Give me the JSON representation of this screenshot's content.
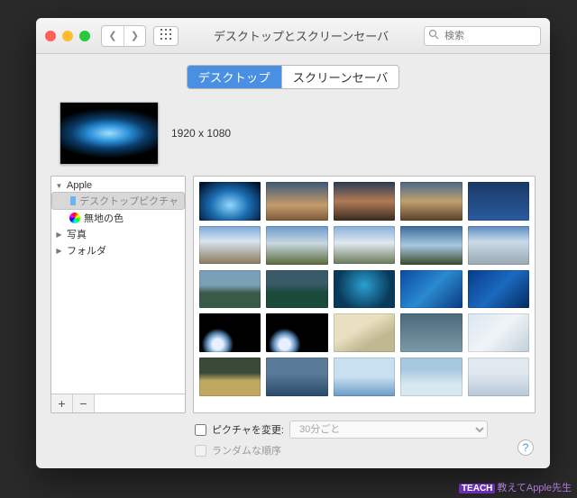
{
  "window": {
    "title": "デスクトップとスクリーンセーバ",
    "search_placeholder": "検索"
  },
  "tabs": {
    "desktop": "デスクトップ",
    "screensaver": "スクリーンセーバ",
    "active": 0
  },
  "preview": {
    "dimensions": "1920 x 1080"
  },
  "sidebar": {
    "items": [
      {
        "label": "Apple",
        "expanded": true,
        "children": [
          {
            "label": "デスクトップピクチャ",
            "icon": "folder",
            "selected": true
          },
          {
            "label": "無地の色",
            "icon": "colorwheel"
          }
        ]
      },
      {
        "label": "写真",
        "expanded": false
      },
      {
        "label": "フォルダ",
        "expanded": false
      }
    ],
    "add": "+",
    "remove": "−"
  },
  "options": {
    "change_label": "ピクチャを変更:",
    "interval": "30分ごと",
    "random_label": "ランダムな順序"
  },
  "help": "?",
  "watermark": {
    "tag": "TEACH",
    "text": "教えてApple先生"
  },
  "thumbs": [
    "radial-gradient(ellipse at 50% 60%, #8fd9ff, #1a6bb0 45%, #02152e 90%)",
    "linear-gradient(#3a5a78 0%, #c59a6a 60%, #7a5a3a 100%)",
    "linear-gradient(to bottom, #2b3d55 0%, #b07a55 50%, #3a2a20 100%)",
    "linear-gradient(#4a6a88 0%, #c0a070 50%, #5a4028 100%)",
    "linear-gradient(#1a3a66, #2a5aa0)",
    "linear-gradient(#7aa8d8 0%, #d8e4ef 40%, #8a7a5a 100%)",
    "linear-gradient(#6a9acc 0%, #c8d8e0 45%, #5a6a3a 100%)",
    "linear-gradient(#88b0d8 0%, #e0e8ef 45%, #6a7a5a 100%)",
    "linear-gradient(#3a6a9a 0%, #a8c8e0 50%, #3a4a2a 100%)",
    "linear-gradient(#5a8ac0 0%, #c8dae8 40%, #9aa8b0 100%)",
    "linear-gradient(#7aa0b8 40%, #3a5a48 60%)",
    "linear-gradient(#3a5a6a 35%, #1a4a3a 60%)",
    "radial-gradient(circle at 50% 40%, #2aa0d0, #0a3a5a 70%)",
    "linear-gradient(135deg, #0a4aa0, #2a8ad0, #0a3a80)",
    "linear-gradient(135deg, #083a88, #1a6ac0, #062a60)",
    "radial-gradient(circle at 30% 80%, #e8f0ff 10%, #6090c0 20%, #000 30%, #000 100%)",
    "radial-gradient(circle at 30% 80%, #e8f0ff 10%, #6090c0 20%, #000 30%, #000 100%)",
    "linear-gradient(150deg, #e8e0c0 40%, #c0b890 70%)",
    "linear-gradient(#4a6a7a, #7a9aa8)",
    "linear-gradient(135deg, #d8e8f0, #f0f4f8, #c0d0d8)",
    "linear-gradient(#3a4a38 40%, #c0a860 60%)",
    "linear-gradient(#5a7a9a 40%, #2a4a6a 100%)",
    "linear-gradient(#c8e0f0 50%, #6a9ac8 100%)",
    "linear-gradient(#a8c8e0 30%, #d8e8f0 70%)",
    "linear-gradient(#e0e8f0 40%, #b8c8d8 100%)"
  ]
}
